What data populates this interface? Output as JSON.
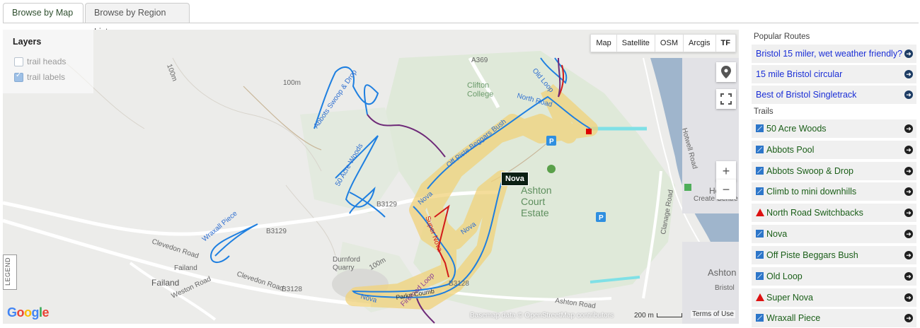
{
  "tabs": [
    {
      "label": "Browse by Map",
      "active": true
    },
    {
      "label": "Browse by Region List",
      "active": false
    }
  ],
  "map": {
    "layers_title": "Layers",
    "layers": [
      {
        "label": "trail heads",
        "checked": false
      },
      {
        "label": "trail labels",
        "checked": true
      }
    ],
    "map_types": [
      "Map",
      "Satellite",
      "OSM",
      "Arcgis",
      "TF"
    ],
    "selected_map_type": "TF",
    "zoom_in": "+",
    "zoom_out": "−",
    "legend_label": "LEGEND",
    "tooltip": "Nova",
    "google_logo": "Google",
    "attribution": "Basemap data © OpenStreetMap contributors",
    "scale": "200 m",
    "terms": "Terms of Use",
    "labels": {
      "a369": "A369",
      "clifton_college": "Clifton\nCollege",
      "ashton_court": "Ashton\nCourt\nEstate",
      "durnford": "Durnford\nQuarry",
      "failand": "Failand",
      "failand2": "Failand",
      "clevedon_road": "Clevedon Road",
      "clevedon_road2": "Clevedon Road",
      "weston_road": "Weston Road",
      "ashton_road": "Ashton Road",
      "b3129": "B3129",
      "b3129b": "B3129",
      "b3128": "B3128",
      "b3128b": "B3128",
      "clanage": "Clanage Road",
      "hotwell": "Hotwell Road",
      "bristol": "Bristol",
      "ashton": "Ashton",
      "hotwel": "Hotwel",
      "create": "Create Centre",
      "c100a": "100m",
      "c100b": "100m",
      "c100c": "100m",
      "t_wrax": "Wraxall Piece",
      "t_oldloop": "Old Loop",
      "t_abbots": "Abbots Swoop & Drop",
      "t_fifty": "50 Acre Woods",
      "t_offpiste": "Off Piste Beggars Bush",
      "t_nova": "Nova",
      "t_nova2": "Nova",
      "t_nova3": "Nova",
      "t_super": "Super Nova",
      "t_fire": "Fireroad Loop",
      "t_parkn": "Parkn Coumb",
      "t_nroad": "North Road"
    }
  },
  "sidebar": {
    "popular_title": "Popular Routes",
    "routes": [
      "Bristol 15 miler, wet weather friendly?",
      "15 mile Bristol circular",
      "Best of Bristol Singletrack"
    ],
    "trails_title": "Trails",
    "trails": [
      {
        "name": "50 Acre Woods",
        "icon": "blue-square-icon"
      },
      {
        "name": "Abbots Pool",
        "icon": "blue-square-icon"
      },
      {
        "name": "Abbots Swoop & Drop",
        "icon": "blue-square-icon"
      },
      {
        "name": "Climb to mini downhills",
        "icon": "blue-square-icon"
      },
      {
        "name": "North Road Switchbacks",
        "icon": "red-triangle-icon"
      },
      {
        "name": "Nova",
        "icon": "blue-square-icon"
      },
      {
        "name": "Off Piste Beggars Bush",
        "icon": "blue-square-icon"
      },
      {
        "name": "Old Loop",
        "icon": "blue-square-icon"
      },
      {
        "name": "Super Nova",
        "icon": "red-triangle-icon"
      },
      {
        "name": "Wraxall Piece",
        "icon": "blue-square-icon"
      }
    ]
  },
  "colors": {
    "trail_blue": "#1e7fe0",
    "trail_red": "#d11a1a",
    "trail_purple": "#6e2a78",
    "highlight": "#f0d27a",
    "park_green": "#d6e6cf",
    "river": "#9fb5cc"
  }
}
